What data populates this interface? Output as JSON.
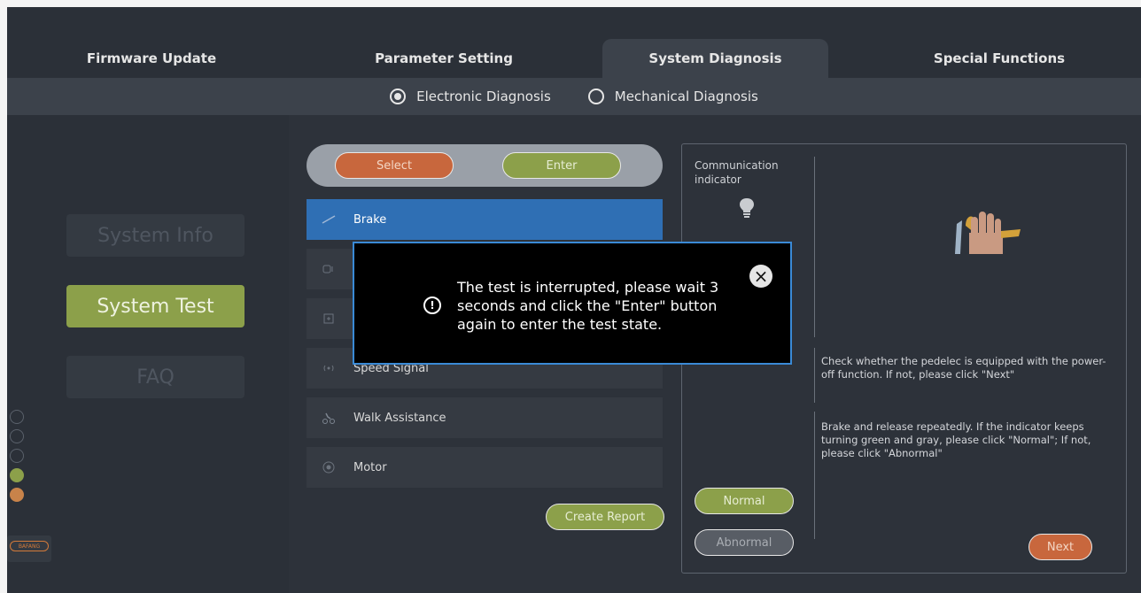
{
  "tabs": [
    {
      "label": "Firmware Update"
    },
    {
      "label": "Parameter Setting"
    },
    {
      "label": "System Diagnosis"
    },
    {
      "label": "Special Functions"
    }
  ],
  "modes": [
    {
      "label": "Electronic Diagnosis",
      "checked": true
    },
    {
      "label": "Mechanical Diagnosis",
      "checked": false
    }
  ],
  "sidebar": {
    "items": [
      {
        "label": "System Info"
      },
      {
        "label": "System Test"
      },
      {
        "label": "FAQ"
      }
    ],
    "icons": [
      "settings-icon",
      "help-icon",
      "power-icon",
      "user-icon",
      "language-icon"
    ],
    "brand": "BAFANG"
  },
  "selector": {
    "select_label": "Select",
    "enter_label": "Enter"
  },
  "tests": [
    {
      "label": "Brake",
      "icon": "brake-icon"
    },
    {
      "label": "",
      "icon": "throttle-icon"
    },
    {
      "label": "",
      "icon": "display-icon"
    },
    {
      "label": "Speed Signal",
      "icon": "speed-signal-icon"
    },
    {
      "label": "Walk Assistance",
      "icon": "walk-assistance-icon"
    },
    {
      "label": "Motor",
      "icon": "motor-icon"
    }
  ],
  "create_report": "Create Report",
  "panel": {
    "comm_label": "Communication indicator",
    "instruction1": "Check whether the pedelec is equipped with the power-off function. If not, please click \"Next\"",
    "instruction2": "Brake and release repeatedly. If the indicator keeps turning green and gray, please click \"Normal\"; If not, please click \"Abnormal\"",
    "normal_label": "Normal",
    "abnormal_label": "Abnormal",
    "next_label": "Next"
  },
  "modal": {
    "message": "The test is interrupted, please wait 3 seconds and click the \"Enter\" button again to enter the test state."
  },
  "colors": {
    "accent_green": "#8ca04a",
    "accent_orange": "#c8673d",
    "selection_blue": "#2f6fb4"
  }
}
